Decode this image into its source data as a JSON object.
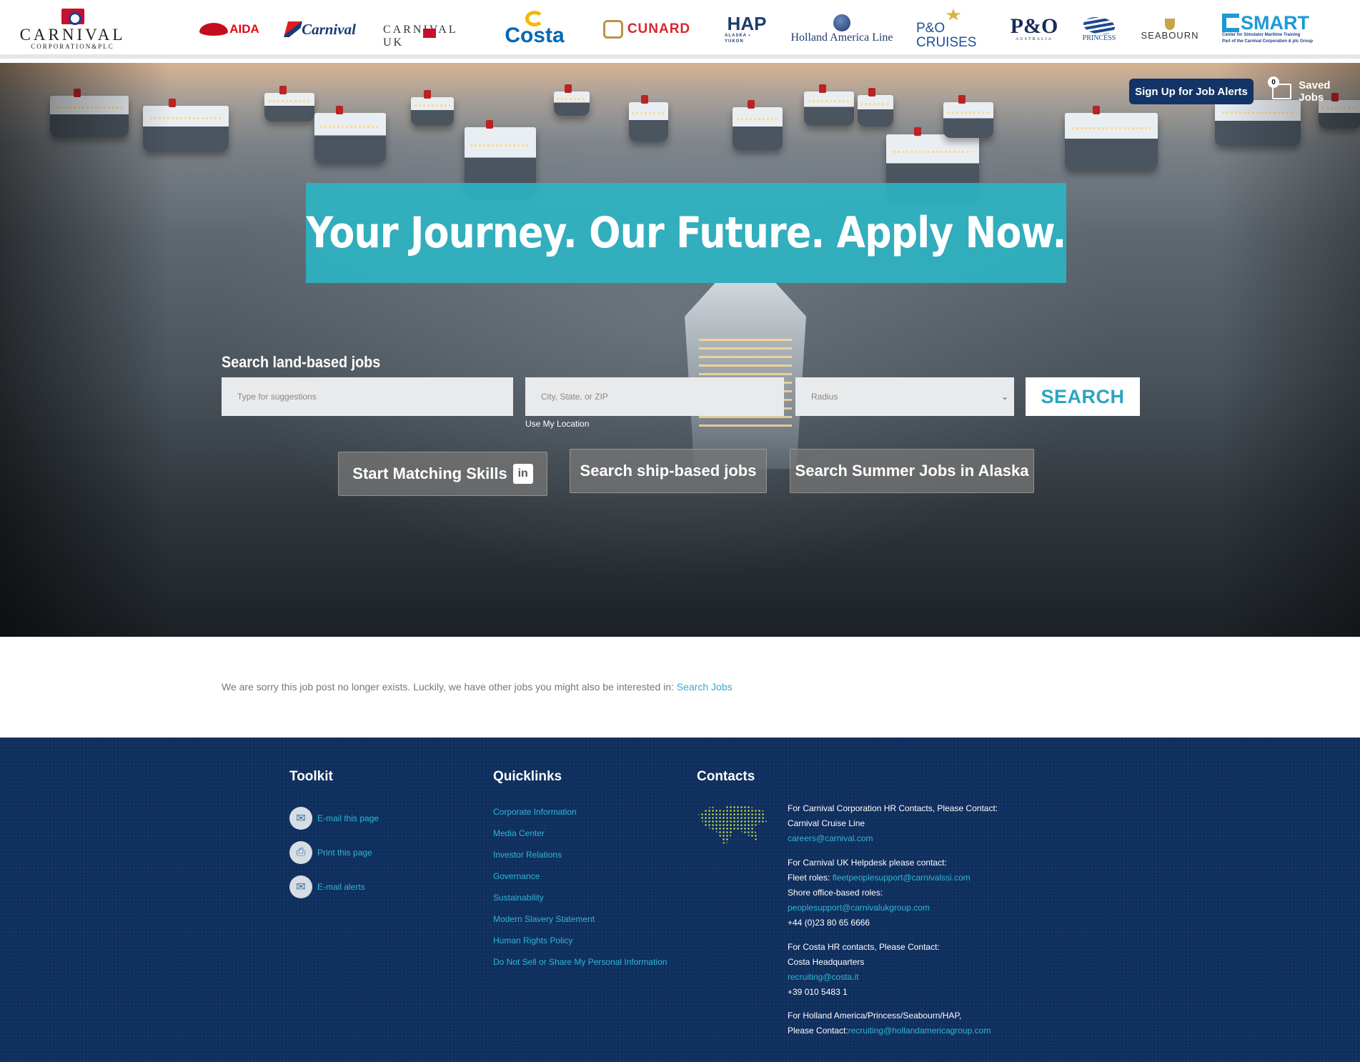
{
  "header": {
    "main_logo": {
      "line1": "CARNIVAL",
      "line2": "CORPORATION&PLC"
    },
    "brands": {
      "aida": "AIDA",
      "carnival": "Carnival",
      "carnival_uk": "CARNIVAL UK",
      "costa": "Costa",
      "cunard": "CUNARD",
      "hap": "HAP",
      "hap_sub": "ALASKA • YUKON",
      "holland_america": "Holland America Line",
      "po_cruises": "P&O CRUISES",
      "po_australia": "P&O",
      "po_australia_sub": "AUSTRALIA",
      "princess": "PRINCESS",
      "seabourn": "SEABOURN",
      "csmart": "SMART",
      "csmart_sub": "Center for Simulator Maritime Training",
      "csmart_sub2": "Part of the Carnival Corporation & plc Group"
    }
  },
  "hero": {
    "headline": "Your Journey. Our Future. Apply Now.",
    "job_alerts_label": "Sign Up for Job Alerts",
    "saved_jobs_label": "Saved Jobs",
    "saved_jobs_count": "0",
    "search_title": "Search land-based jobs",
    "keyword_placeholder": "Type for suggestions",
    "location_placeholder": "City, State, or ZIP",
    "radius_placeholder": "Radius",
    "use_location": "Use My Location",
    "search_button": "SEARCH",
    "buttons": {
      "matching": "Start Matching Skills",
      "ship_based": "Search ship-based jobs",
      "alaska": "Search Summer Jobs in Alaska"
    }
  },
  "message": {
    "text": "We are sorry this job post no longer exists. Luckily, we have other jobs you might also be interested in:",
    "link": "Search Jobs"
  },
  "footer": {
    "toolkit_title": "Toolkit",
    "toolkit": [
      "E-mail this page",
      "Print this page",
      "E-mail alerts"
    ],
    "quicklinks_title": "Quicklinks",
    "quicklinks": [
      "Corporate Information",
      "Media Center",
      "Investor Relations",
      "Governance",
      "Sustainability",
      "Modern Slavery Statement",
      "Human Rights Policy",
      "Do Not Sell or Share My Personal Information"
    ],
    "contacts_title": "Contacts",
    "contacts": {
      "c1": "For Carnival Corporation HR Contacts, Please Contact:",
      "c2": "Carnival Cruise Line",
      "c3": "careers@carnival.com",
      "c4": "For Carnival UK Helpdesk please contact:",
      "c5_label": "Fleet roles: ",
      "c5_email": "fleetpeoplesupport@carnivalssi.com",
      "c6": "Shore office-based roles:",
      "c7": "peoplesupport@carnivalukgroup.com",
      "c8": "+44 (0)23 80 65 6666",
      "c9": "For Costa HR contacts, Please Contact:",
      "c10": "Costa Headquarters",
      "c11": "recruiting@costa.it",
      "c12": "+39 010 5483 1",
      "c13": "For Holland America/Princess/Seabourn/HAP,",
      "c14_label": "Please Contact:",
      "c14_email": "recruiting@hollandamericagroup.com"
    }
  },
  "colors": {
    "accent": "#2AB6C6",
    "footer_bg": "#0F2F5E",
    "link": "#2DB8D4",
    "alert_btn": "#123466"
  }
}
